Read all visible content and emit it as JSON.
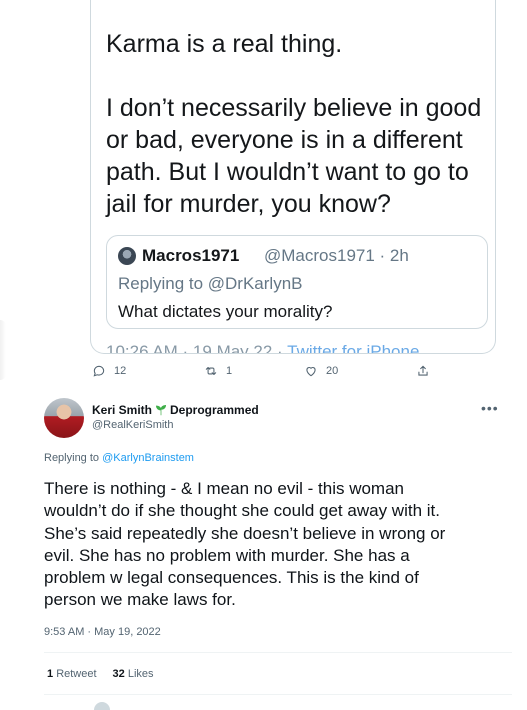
{
  "quoted_screenshot": {
    "lines": [
      "Karma is a real thing.",
      "",
      "I don’t necessarily believe in good",
      "or bad, everyone is in a different",
      "path. But I wouldn’t want to go to",
      "jail for murder, you know?"
    ],
    "inner_tweet": {
      "name": "Macros1971",
      "handle_time": "@Macros1971 · 2h",
      "replying_to": "Replying to @DrKarlynB",
      "text": "What dictates your morality?"
    },
    "cut_off_meta": "10:26 AM · 19 May 22 ·",
    "cut_off_source": "Twitter for iPhone"
  },
  "quoted_actions": {
    "replies": "12",
    "retweets": "1",
    "likes": "20"
  },
  "reply_tweet": {
    "name": "Keri Smith",
    "badge_text": "Deprogrammed",
    "handle": "@RealKeriSmith",
    "replying_prefix": "Replying to",
    "replying_mention": "@KarlynBrainstem",
    "body_lines": [
      "There is nothing - & I mean no evil - this woman",
      "wouldn’t do if she thought she could get away with it.",
      "She’s said repeatedly she doesn’t believe in wrong or",
      "evil. She has no problem with murder. She has a",
      "problem w legal consequences. This is the kind of",
      "person we make laws for."
    ],
    "timestamp": "9:53 AM · May 19, 2022",
    "retweet_count": "1",
    "retweet_label": "Retweet",
    "like_count": "32",
    "like_label": "Likes"
  },
  "icons": [
    "comment-icon",
    "retweet-icon",
    "heart-icon",
    "share-icon",
    "seedling-icon",
    "more-icon"
  ],
  "colors": {
    "link_blue": "#1d9bf0",
    "muted_gray": "#536471",
    "seedling_green": "#3fae49"
  }
}
